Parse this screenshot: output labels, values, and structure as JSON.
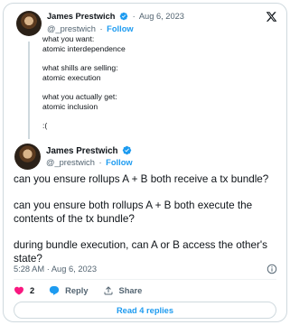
{
  "parent_tweet": {
    "author_name": "James Prestwich",
    "date": "Aug 6, 2023",
    "handle": "@_prestwich",
    "follow_label": "Follow",
    "lines": [
      "what you want:",
      "atomic interdependence",
      "",
      "what shills are selling:",
      "atomic execution",
      "",
      "what you actually get:",
      "atomic inclusion",
      "",
      ":("
    ]
  },
  "main_tweet": {
    "author_name": "James Prestwich",
    "handle": "@_prestwich",
    "follow_label": "Follow",
    "paragraphs": [
      "can you ensure rollups A + B both receive a tx bundle?",
      "can you ensure both rollups A + B both execute the contents of the tx bundle?",
      "during bundle execution, can A or B access the other's state?"
    ],
    "timestamp": "5:28 AM · Aug 6, 2023",
    "like_count": "2",
    "reply_label": "Reply",
    "share_label": "Share",
    "read_replies_label": "Read 4 replies"
  },
  "icons": {
    "platform": "x-logo-icon",
    "verified": "verified-badge-icon",
    "info": "info-icon",
    "like": "heart-icon",
    "reply": "reply-bubble-icon",
    "share": "share-icon"
  },
  "colors": {
    "accent": "#1d9bf0",
    "like": "#f91880",
    "text": "#0f1419",
    "muted": "#536471",
    "border": "#cfd9de"
  }
}
